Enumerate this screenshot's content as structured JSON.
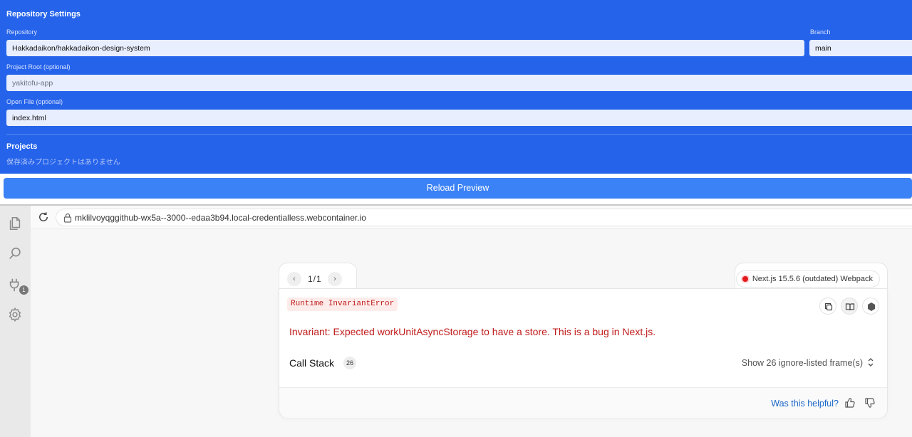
{
  "settings": {
    "title": "Repository Settings",
    "repository_label": "Repository",
    "repository_value": "Hakkadaikon/hakkadaikon-design-system",
    "branch_label": "Branch",
    "branch_value": "main",
    "project_root_label": "Project Root (optional)",
    "project_root_placeholder": "yakitofu-app",
    "open_file_label": "Open File (optional)",
    "open_file_value": "index.html",
    "projects_title": "Projects",
    "projects_empty": "保存済みプロジェクトはありません"
  },
  "reload_label": "Reload Preview",
  "activity": {
    "badge_count": "1"
  },
  "browser": {
    "url": "mklilvoyqggithub-wx5a--3000--edaa3b94.local-credentialless.webcontainer.io"
  },
  "error_overlay": {
    "page_indicator": "1/1",
    "version_label": "Next.js 15.5.6 (outdated) Webpack",
    "error_type": "Runtime InvariantError",
    "message": "Invariant: Expected workUnitAsyncStorage to have a store. This is a bug in Next.js.",
    "call_stack_label": "Call Stack",
    "call_stack_count": "26",
    "show_frames_label": "Show 26 ignore-listed frame(s)",
    "helpful_label": "Was this helpful?"
  },
  "colors": {
    "panel_blue": "#2563eb",
    "button_blue": "#3b82f6",
    "error_red": "#c01b1b",
    "link_blue": "#1a66c8"
  },
  "icons": [
    "files-icon",
    "search-icon",
    "plug-icon",
    "gear-icon",
    "refresh-icon",
    "lock-icon",
    "copy-icon",
    "book-icon",
    "hexagon-icon",
    "thumbs-up-icon",
    "thumbs-down-icon"
  ]
}
